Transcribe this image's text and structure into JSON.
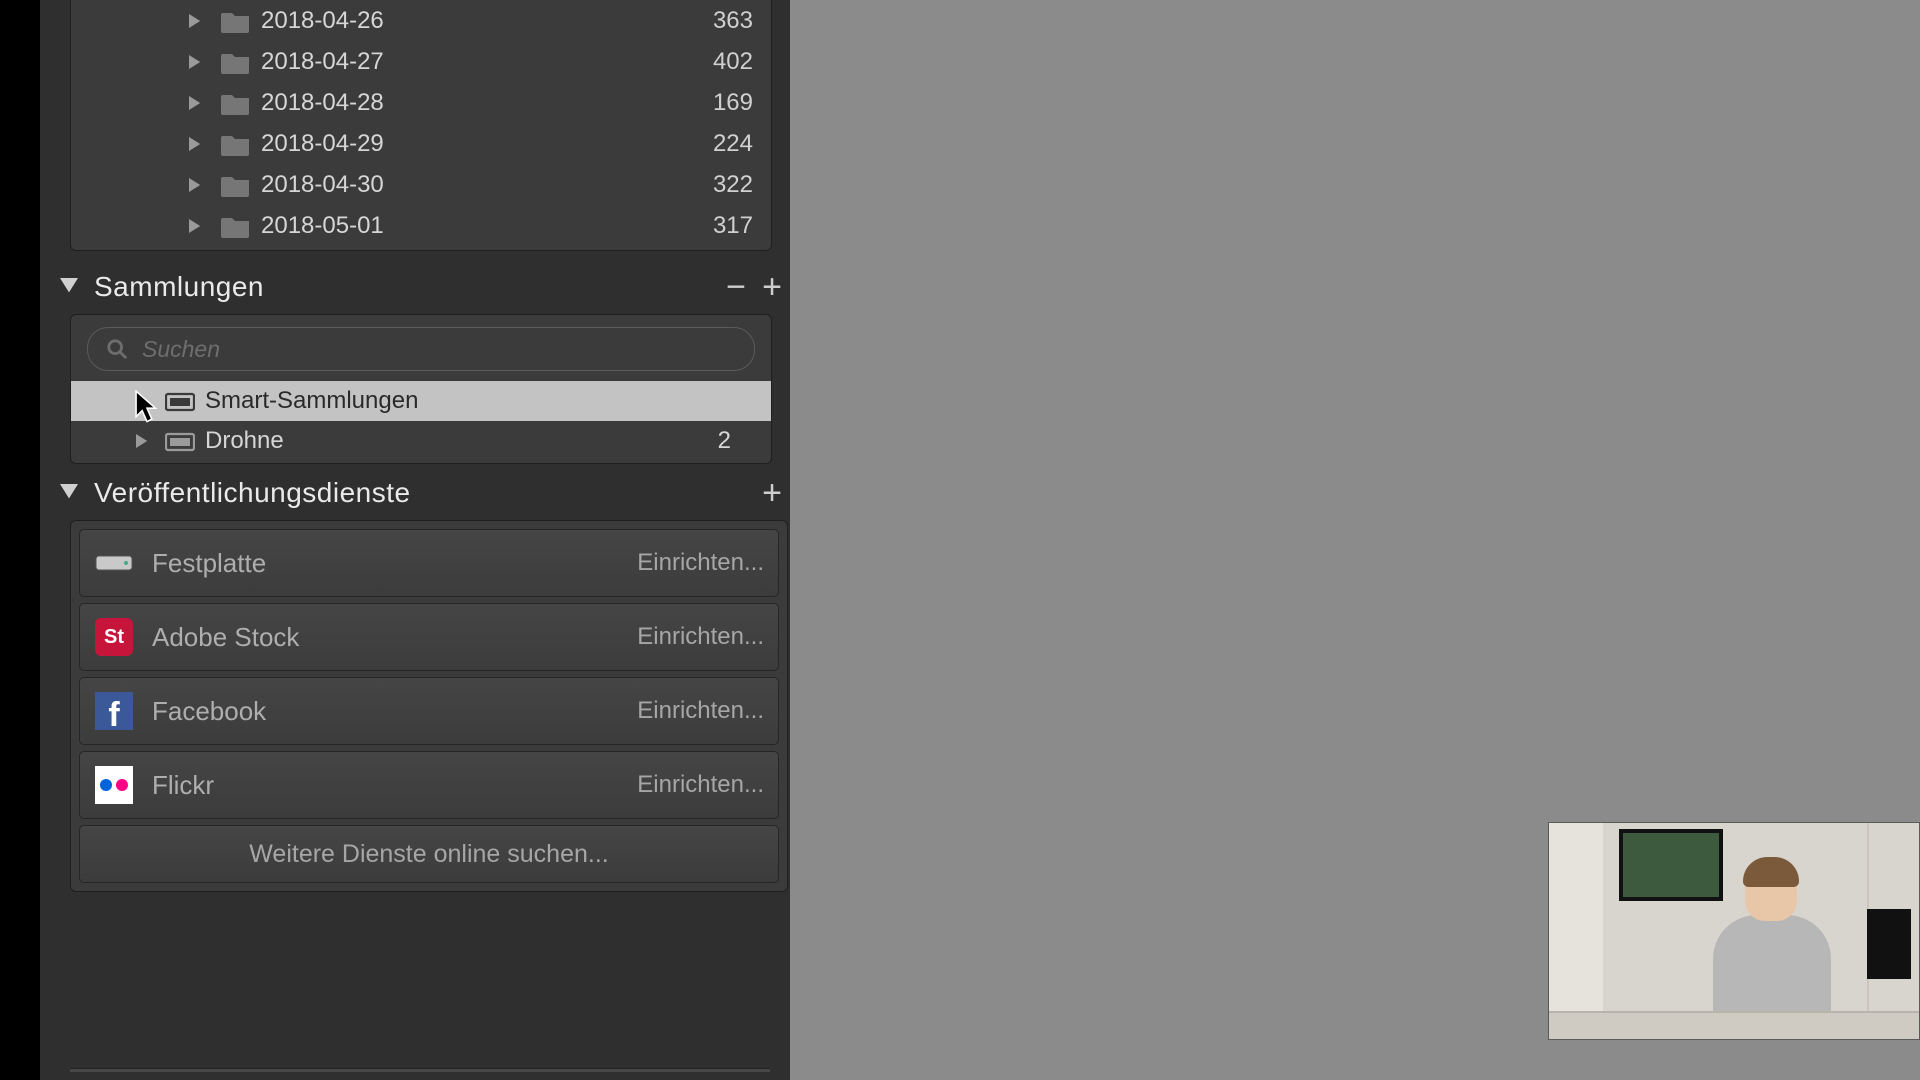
{
  "folders": [
    {
      "name": "2018-04-26",
      "count": "363"
    },
    {
      "name": "2018-04-27",
      "count": "402"
    },
    {
      "name": "2018-04-28",
      "count": "169"
    },
    {
      "name": "2018-04-29",
      "count": "224"
    },
    {
      "name": "2018-04-30",
      "count": "322"
    },
    {
      "name": "2018-05-01",
      "count": "317"
    }
  ],
  "collections_header": {
    "title": "Sammlungen",
    "minus": "−",
    "plus": "+"
  },
  "search": {
    "placeholder": "Suchen"
  },
  "collections": [
    {
      "name": "Smart-Sammlungen",
      "count": "",
      "selected": true,
      "icon": "smart"
    },
    {
      "name": "Drohne",
      "count": "2",
      "selected": false,
      "icon": "set"
    }
  ],
  "publish_header": {
    "title": "Veröffentlichungsdienste",
    "plus": "+"
  },
  "setup_label": "Einrichten...",
  "services": [
    {
      "name": "Festplatte",
      "icon": "hdd"
    },
    {
      "name": "Adobe Stock",
      "icon": "adobestock"
    },
    {
      "name": "Facebook",
      "icon": "facebook"
    },
    {
      "name": "Flickr",
      "icon": "flickr"
    }
  ],
  "more_services": "Weitere Dienste online suchen...",
  "colors": {
    "adobestock_bg": "#c6143a",
    "facebook_bg": "#3b5998",
    "flickr_blue": "#0063dc",
    "flickr_pink": "#ff0084"
  }
}
